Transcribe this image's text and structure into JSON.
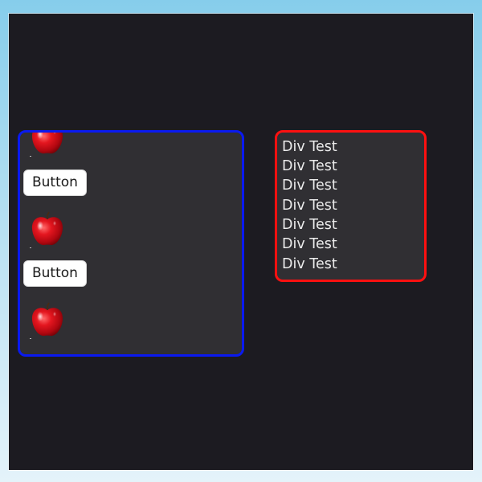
{
  "scroll_panel": {
    "border_color": "#0a1af0",
    "items": [
      {
        "type": "image",
        "icon": "apple-icon"
      },
      {
        "type": "button",
        "label": "Button"
      },
      {
        "type": "image",
        "icon": "apple-icon"
      },
      {
        "type": "button",
        "label": "Button"
      },
      {
        "type": "image",
        "icon": "apple-icon"
      }
    ]
  },
  "text_panel": {
    "border_color": "#ff1010",
    "lines": [
      "Div Test",
      "Div Test",
      "Div Test",
      "Div Test",
      "Div Test",
      "Div Test",
      "Div Test"
    ]
  },
  "colors": {
    "window_background": "#1c1b21",
    "panel_background": "#302f33",
    "text": "#ececec",
    "button_background": "#ffffff"
  }
}
